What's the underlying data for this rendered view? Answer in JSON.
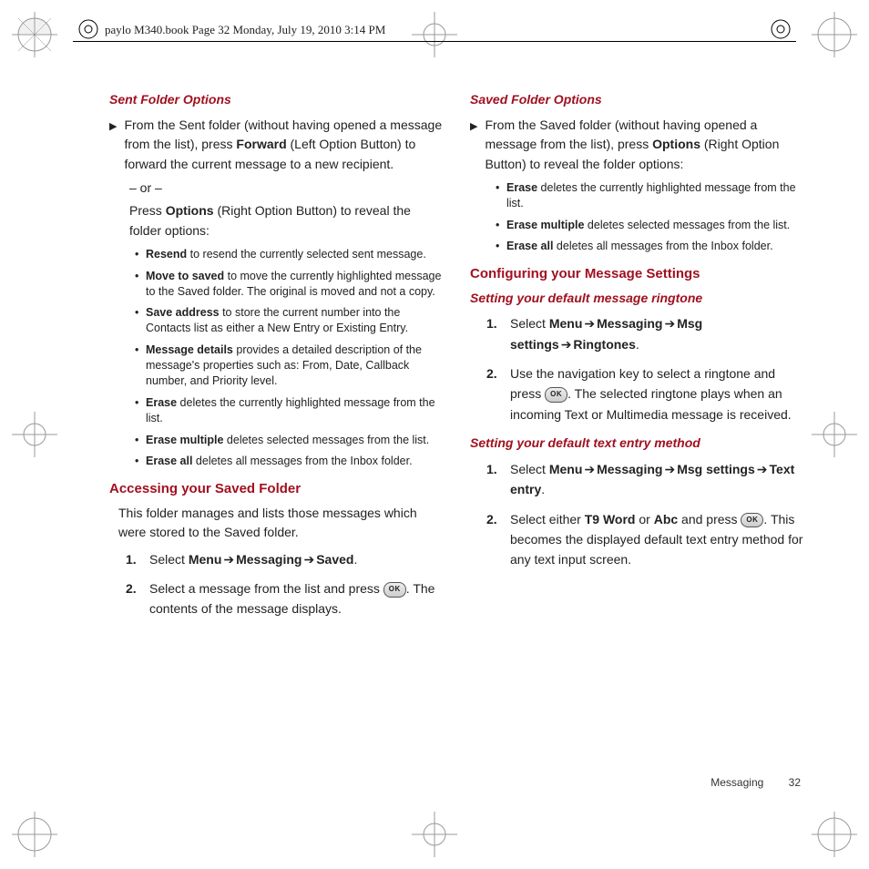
{
  "header": "paylo M340.book  Page 32  Monday, July 19, 2010  3:14 PM",
  "footer": {
    "section": "Messaging",
    "page": "32"
  },
  "left": {
    "h_sent": "Sent Folder Options",
    "sent_intro_a": "From the Sent folder (without having opened a message from the list), press ",
    "sent_intro_b": "Forward",
    "sent_intro_c": " (Left Option Button) to forward the current message to a new recipient.",
    "or": "– or –",
    "sent_alt_a": "Press ",
    "sent_alt_b": "Options",
    "sent_alt_c": " (Right Option Button) to reveal the folder options:",
    "b1_a": "Resend",
    "b1_b": " to resend the currently selected sent message.",
    "b2_a": "Move to saved",
    "b2_b": " to move the currently highlighted message to the Saved folder. The original is moved and not a copy.",
    "b3_a": "Save address",
    "b3_b": " to store the current number into the Contacts list as either a New Entry or Existing Entry.",
    "b4_a": "Message details",
    "b4_b": " provides a detailed description of the message's properties such as: From, Date, Callback number, and Priority level.",
    "b5_a": "Erase",
    "b5_b": " deletes the currently highlighted message from the list.",
    "b6_a": "Erase multiple",
    "b6_b": " deletes selected messages from the list.",
    "b7_a": "Erase all",
    "b7_b": " deletes all messages from the Inbox folder.",
    "h_access": "Accessing your Saved Folder",
    "access_intro": "This folder manages and lists those messages which were stored to the Saved folder.",
    "s1_n": "1.",
    "s1_a": "Select ",
    "s1_b": "Menu",
    "s1_c": "Messaging",
    "s1_d": "Saved",
    "s1_e": ".",
    "s2_n": "2.",
    "s2_a": "Select a message from the list and press ",
    "s2_b": ". The contents of the message displays."
  },
  "right": {
    "h_saved": "Saved Folder Options",
    "saved_intro_a": "From the Saved folder (without having opened a message from the list), press ",
    "saved_intro_b": "Options",
    "saved_intro_c": " (Right Option Button) to reveal the folder options:",
    "rb1_a": "Erase",
    "rb1_b": " deletes the currently highlighted message from the list.",
    "rb2_a": "Erase multiple",
    "rb2_b": " deletes selected messages from the list.",
    "rb3_a": "Erase all",
    "rb3_b": " deletes all messages from the Inbox folder.",
    "h_config": "Configuring your Message Settings",
    "h_ringtone": "Setting your default message ringtone",
    "r1_n": "1.",
    "r1_a": "Select ",
    "r1_b": "Menu",
    "r1_c": "Messaging",
    "r1_d": "Msg settings",
    "r1_e": "Ringtones",
    "r1_f": ".",
    "r2_n": "2.",
    "r2_a": "Use the navigation key to select a ringtone and press ",
    "r2_b": ". The selected ringtone plays when an incoming Text or Multimedia message is received.",
    "h_textentry": "Setting your default text entry method",
    "t1_n": "1.",
    "t1_a": "Select ",
    "t1_b": "Menu",
    "t1_c": "Messaging",
    "t1_d": "Msg settings",
    "t1_e": "Text entry",
    "t1_f": ".",
    "t2_n": "2.",
    "t2_a": "Select either ",
    "t2_b": "T9 Word",
    "t2_c": " or ",
    "t2_d": "Abc",
    "t2_e": " and press ",
    "t2_f": ". This becomes the displayed default text entry method for any text input screen."
  },
  "arrow": "➔",
  "ok": "OK"
}
